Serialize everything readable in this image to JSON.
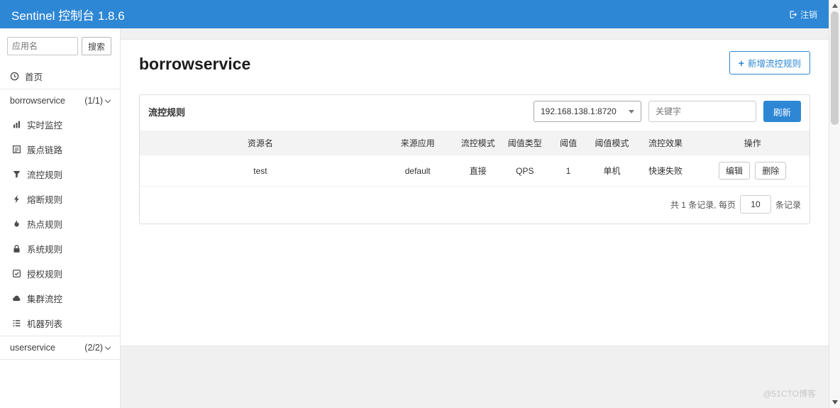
{
  "colors": {
    "brand_blue": "#2d87d5",
    "watermark_gray": "#c9c9c9"
  },
  "header": {
    "brand": "Sentinel 控制台 1.8.6",
    "logout_label": "注销"
  },
  "sidebar": {
    "search_placeholder": "应用名",
    "search_button": "搜索",
    "home_label": "首页",
    "app1": {
      "name": "borrowservice",
      "count": "(1/1)"
    },
    "menus": [
      {
        "label": "实时监控"
      },
      {
        "label": "簇点链路"
      },
      {
        "label": "流控规则"
      },
      {
        "label": "熔断规则"
      },
      {
        "label": "热点规则"
      },
      {
        "label": "系统规则"
      },
      {
        "label": "授权规则"
      },
      {
        "label": "集群流控"
      },
      {
        "label": "机器列表"
      }
    ],
    "app2": {
      "name": "userservice",
      "count": "(2/2)"
    }
  },
  "main": {
    "title": "borrowservice",
    "add_plus": "+",
    "add_rule_label": "新增流控规则",
    "panel": {
      "title": "流控规则",
      "machine_select": "192.168.138.1:8720",
      "keyword_placeholder": "关键字",
      "refresh_button": "刷新"
    },
    "table": {
      "headers": [
        "资源名",
        "来源应用",
        "流控模式",
        "阈值类型",
        "阈值",
        "阈值模式",
        "流控效果",
        "操作"
      ],
      "rows": [
        {
          "resource": "test",
          "source": "default",
          "mode": "直接",
          "threshold_type": "QPS",
          "threshold": "1",
          "threshold_mode": "单机",
          "effect": "快速失败",
          "edit": "编辑",
          "delete": "删除"
        }
      ],
      "pagination": {
        "total_prefix": "共 1 条记录, 每页",
        "page_size": "10",
        "total_suffix": "条记录"
      }
    }
  },
  "watermark": "@51CTO博客"
}
